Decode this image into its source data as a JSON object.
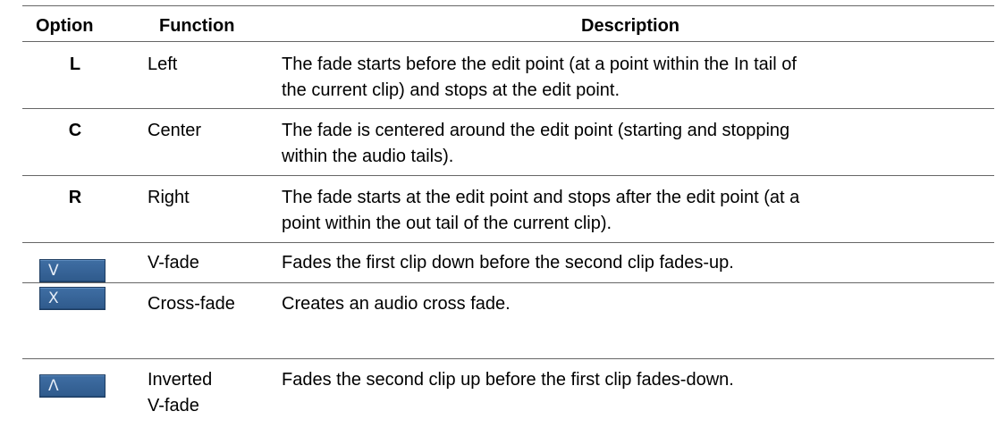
{
  "table": {
    "headers": {
      "option": "Option",
      "function": "Function",
      "description": "Description"
    },
    "rows": [
      {
        "option": "L",
        "function": "Left",
        "desc1": "The fade starts before the edit point (at a point within the In tail of",
        "desc2": "the current clip) and stops at the edit point."
      },
      {
        "option": "C",
        "function": "Center",
        "desc1": "The fade is centered around the edit point (starting and stopping",
        "desc2": "within the audio tails)."
      },
      {
        "option": "R",
        "function": "Right",
        "desc1": "The fade starts at the edit point and stops after the edit point (at a",
        "desc2": "point within the out tail of the current clip)."
      },
      {
        "option_button": "V",
        "function": "V-fade",
        "desc1": "Fades the first clip down before the second clip fades-up."
      },
      {
        "option_button": "X",
        "function": "Cross-fade",
        "desc1": "Creates an audio cross fade."
      },
      {
        "option_button": "Λ",
        "function1": "Inverted",
        "function2": "V-fade",
        "desc1": "Fades the second clip up before the first clip fades-down."
      }
    ]
  },
  "colors": {
    "button_bg": "#3a6799",
    "button_text": "#e6eef8",
    "rule": "#666666"
  }
}
